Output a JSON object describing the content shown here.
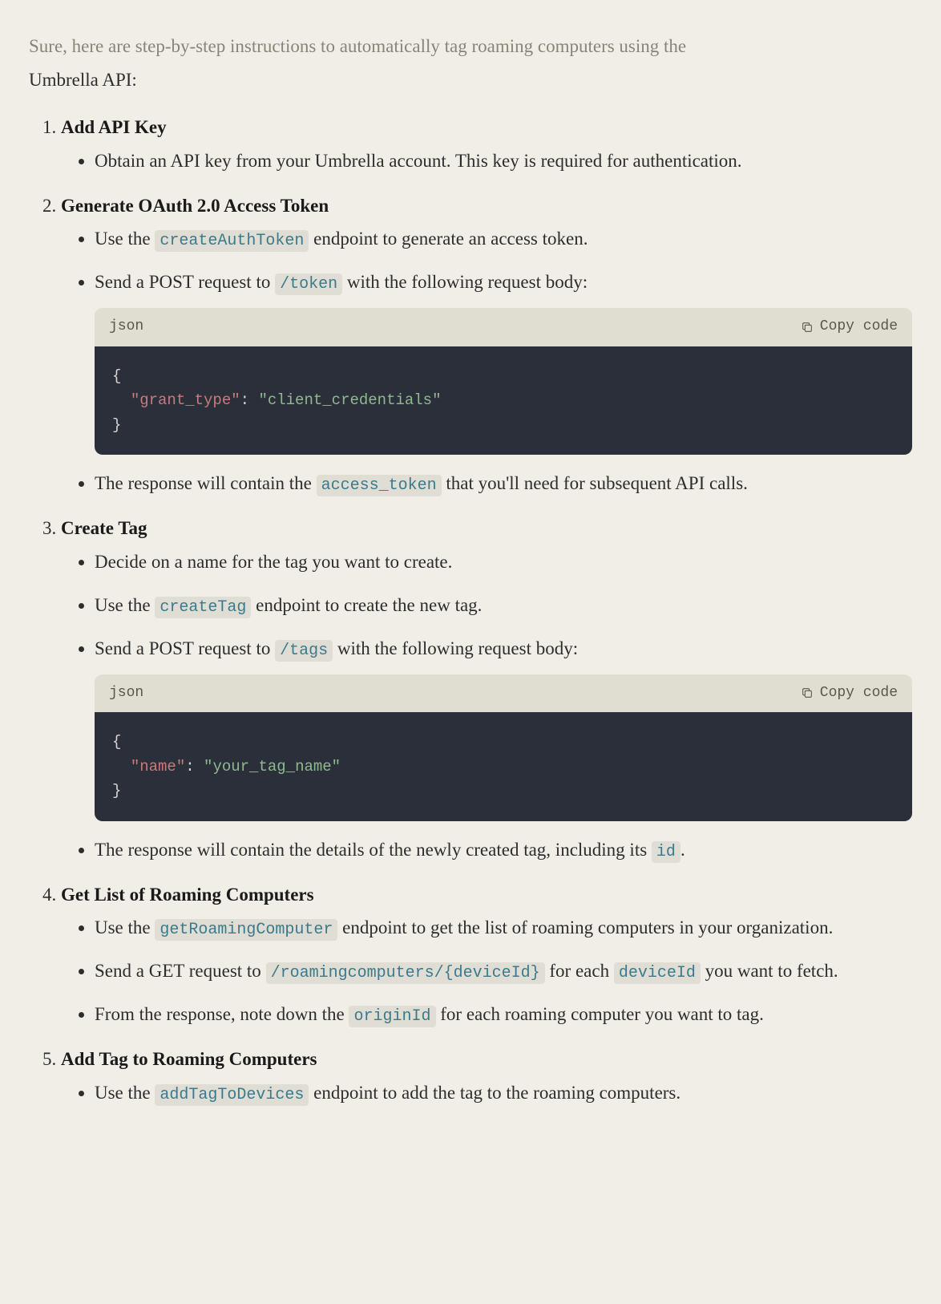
{
  "intro_faded": "Sure, here are step-by-step instructions to automatically tag roaming computers using the",
  "intro_rest": "Umbrella API:",
  "copy_label": "Copy code",
  "steps": [
    {
      "title": "Add API Key",
      "items": [
        {
          "type": "text",
          "text": "Obtain an API key from your Umbrella account. This key is required for authentication."
        }
      ]
    },
    {
      "title": "Generate OAuth 2.0 Access Token",
      "items": [
        {
          "type": "rich",
          "parts": [
            {
              "t": "text",
              "v": "Use the "
            },
            {
              "t": "code",
              "v": "createAuthToken"
            },
            {
              "t": "text",
              "v": " endpoint to generate an access token."
            }
          ]
        },
        {
          "type": "rich_with_code",
          "parts": [
            {
              "t": "text",
              "v": "Send a POST request to "
            },
            {
              "t": "code",
              "v": "/token"
            },
            {
              "t": "text",
              "v": " with the following request body:"
            }
          ],
          "code": {
            "lang": "json",
            "key": "\"grant_type\"",
            "val": "\"client_credentials\""
          }
        },
        {
          "type": "rich",
          "parts": [
            {
              "t": "text",
              "v": "The response will contain the "
            },
            {
              "t": "code",
              "v": "access_token"
            },
            {
              "t": "text",
              "v": " that you'll need for subsequent API calls."
            }
          ]
        }
      ]
    },
    {
      "title": "Create Tag",
      "items": [
        {
          "type": "text",
          "text": "Decide on a name for the tag you want to create."
        },
        {
          "type": "rich",
          "parts": [
            {
              "t": "text",
              "v": "Use the "
            },
            {
              "t": "code",
              "v": "createTag"
            },
            {
              "t": "text",
              "v": " endpoint to create the new tag."
            }
          ]
        },
        {
          "type": "rich_with_code",
          "parts": [
            {
              "t": "text",
              "v": "Send a POST request to "
            },
            {
              "t": "code",
              "v": "/tags"
            },
            {
              "t": "text",
              "v": " with the following request body:"
            }
          ],
          "code": {
            "lang": "json",
            "key": "\"name\"",
            "val": "\"your_tag_name\""
          }
        },
        {
          "type": "rich",
          "parts": [
            {
              "t": "text",
              "v": "The response will contain the details of the newly created tag, including its "
            },
            {
              "t": "code",
              "v": "id"
            },
            {
              "t": "text",
              "v": "."
            }
          ]
        }
      ]
    },
    {
      "title": "Get List of Roaming Computers",
      "items": [
        {
          "type": "rich",
          "parts": [
            {
              "t": "text",
              "v": "Use the "
            },
            {
              "t": "code",
              "v": "getRoamingComputer"
            },
            {
              "t": "text",
              "v": " endpoint to get the list of roaming computers in your organization."
            }
          ]
        },
        {
          "type": "rich",
          "parts": [
            {
              "t": "text",
              "v": "Send a GET request to "
            },
            {
              "t": "code",
              "v": "/roamingcomputers/{deviceId}"
            },
            {
              "t": "text",
              "v": " for each "
            },
            {
              "t": "code",
              "v": "deviceId"
            },
            {
              "t": "text",
              "v": " you want to fetch."
            }
          ]
        },
        {
          "type": "rich",
          "parts": [
            {
              "t": "text",
              "v": "From the response, note down the "
            },
            {
              "t": "code",
              "v": "originId"
            },
            {
              "t": "text",
              "v": " for each roaming computer you want to tag."
            }
          ]
        }
      ]
    },
    {
      "title": "Add Tag to Roaming Computers",
      "items": [
        {
          "type": "rich",
          "parts": [
            {
              "t": "text",
              "v": "Use the "
            },
            {
              "t": "code",
              "v": "addTagToDevices"
            },
            {
              "t": "text",
              "v": " endpoint to add the tag to the roaming computers."
            }
          ]
        }
      ]
    }
  ]
}
